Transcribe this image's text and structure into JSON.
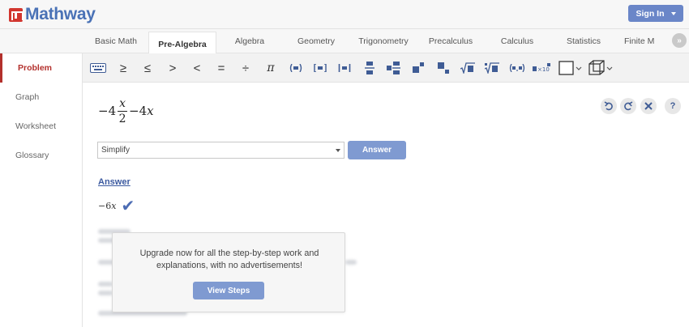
{
  "app": {
    "name": "Mathway"
  },
  "header": {
    "signin_label": "Sign In"
  },
  "tabs": [
    {
      "label": "Basic Math"
    },
    {
      "label": "Pre-Algebra"
    },
    {
      "label": "Algebra"
    },
    {
      "label": "Geometry"
    },
    {
      "label": "Trigonometry"
    },
    {
      "label": "Precalculus"
    },
    {
      "label": "Calculus"
    },
    {
      "label": "Statistics"
    },
    {
      "label": "Finite M"
    }
  ],
  "active_tab": "Pre-Algebra",
  "sidebar": {
    "items": [
      {
        "label": "Problem"
      },
      {
        "label": "Graph"
      },
      {
        "label": "Worksheet"
      },
      {
        "label": "Glossary"
      }
    ]
  },
  "toolbar": {
    "symbols": [
      "≥",
      "≤",
      ">",
      "<",
      "=",
      "÷",
      "π"
    ]
  },
  "problem": {
    "leading": "−4",
    "frac_num": "x",
    "frac_den": "2",
    "rest_coef": "−4",
    "rest_var": "x"
  },
  "operation": {
    "selected": "Simplify"
  },
  "buttons": {
    "answer": "Answer",
    "view_steps": "View Steps"
  },
  "answer": {
    "title": "Answer",
    "value_coef": "−6",
    "value_var": "x"
  },
  "upgrade": {
    "message": "Upgrade now for all the step-by-step work and explanations, with no advertisements!"
  },
  "colors": {
    "brand": "#4a72b6",
    "accent": "#b3302c",
    "button": "#7f9ad1"
  }
}
